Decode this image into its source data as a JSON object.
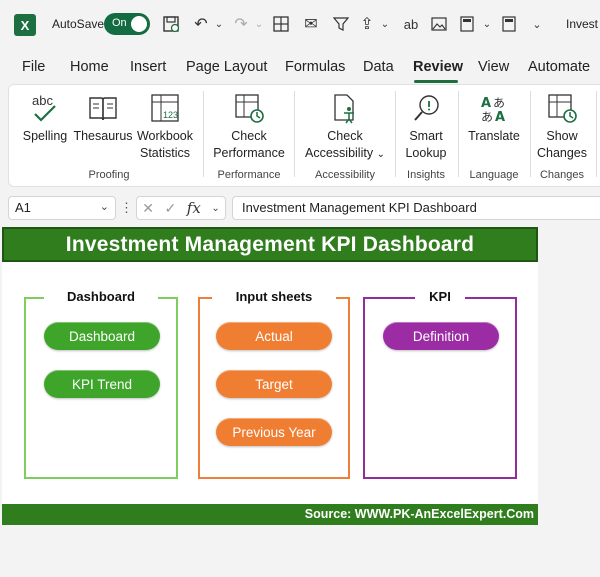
{
  "titlebar": {
    "autosave_label": "AutoSave",
    "autosave_state": "On",
    "window_title": "Invest"
  },
  "tabs": [
    "File",
    "Home",
    "Insert",
    "Page Layout",
    "Formulas",
    "Data",
    "Review",
    "View",
    "Automate"
  ],
  "active_tab": "Review",
  "ribbon": {
    "buttons": {
      "spelling": "Spelling",
      "thesaurus": "Thesaurus",
      "workbook_line1": "Workbook",
      "workbook_line2": "Statistics",
      "check_perf_line1": "Check",
      "check_perf_line2": "Performance",
      "check_acc_line1": "Check",
      "check_acc_line2": "Accessibility",
      "smart_line1": "Smart",
      "smart_line2": "Lookup",
      "translate": "Translate",
      "show_line1": "Show",
      "show_line2": "Changes"
    },
    "groups": {
      "proofing": "Proofing",
      "performance": "Performance",
      "accessibility": "Accessibility",
      "insights": "Insights",
      "language": "Language",
      "changes": "Changes"
    }
  },
  "formula_bar": {
    "name_box": "A1",
    "content": "Investment Management KPI Dashboard"
  },
  "sheet": {
    "banner_title": "Investment Management KPI Dashboard",
    "footer_source": "Source: WWW.PK-AnExcelExpert.Com",
    "panels": {
      "dashboard": {
        "title": "Dashboard",
        "buttons": [
          "Dashboard",
          "KPI Trend"
        ]
      },
      "input": {
        "title": "Input sheets",
        "buttons": [
          "Actual",
          "Target",
          "Previous Year"
        ]
      },
      "kpi": {
        "title": "KPI",
        "buttons": [
          "Definition"
        ]
      }
    }
  },
  "colors": {
    "excel_green": "#1d6f42",
    "banner_green": "#2f7d1d",
    "panel_green": "#7ccf5e",
    "pill_green": "#3ea52a",
    "panel_orange": "#ee7f3b",
    "pill_orange": "#ef7e33",
    "panel_purple": "#8e2f9a",
    "pill_purple": "#9b2ca3"
  }
}
